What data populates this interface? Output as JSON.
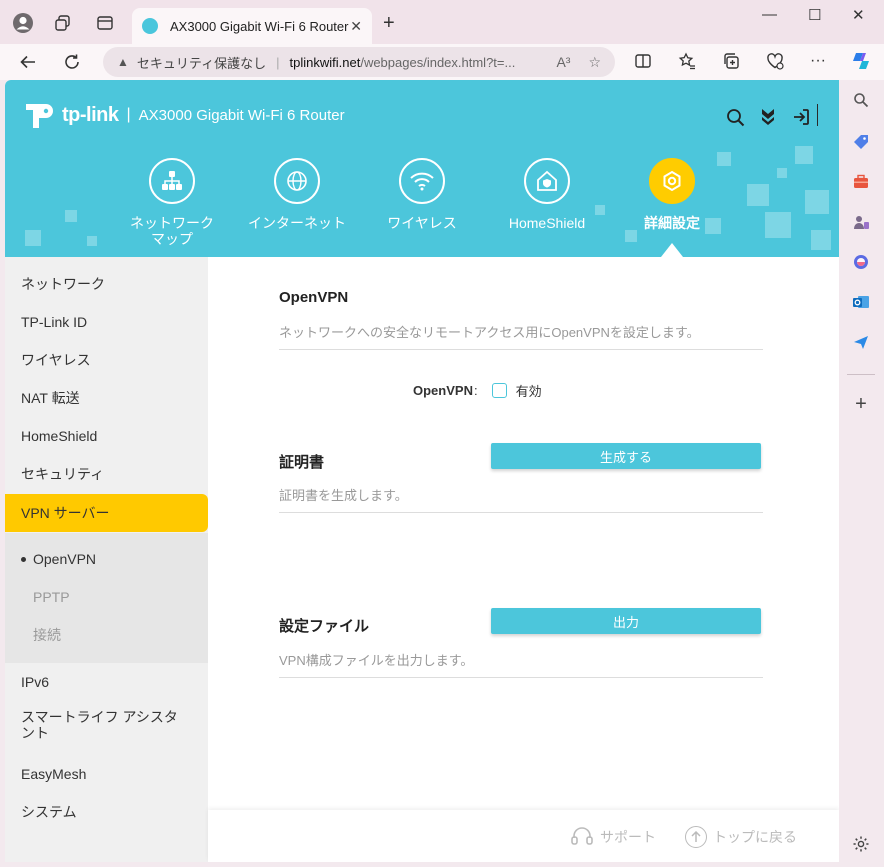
{
  "browser": {
    "tab_title": "AX3000 Gigabit Wi-Fi 6 Router",
    "tab_close": "✕",
    "new_tab": "+",
    "security_text": "セキュリティ保護なし",
    "url_host": "tplinkwifi.net",
    "url_path": "/webpages/index.html?t=...",
    "read_aloud": "A³",
    "fav_star": "☆",
    "menu_dots": "···",
    "win_min": "—",
    "win_max": "☐",
    "win_close": "✕"
  },
  "router": {
    "brand": "tp-link",
    "separator": "|",
    "model": "AX3000 Gigabit Wi-Fi 6 Router",
    "nav": [
      {
        "label": "ネットワーク\nマップ",
        "icon": "network-map-icon"
      },
      {
        "label": "インターネット",
        "icon": "globe-icon"
      },
      {
        "label": "ワイヤレス",
        "icon": "wifi-icon"
      },
      {
        "label": "HomeShield",
        "icon": "home-shield-icon"
      },
      {
        "label": "詳細設定",
        "icon": "gear-icon",
        "active": true
      }
    ],
    "sidebar": {
      "items": [
        {
          "label": "ネットワーク"
        },
        {
          "label": "TP-Link ID"
        },
        {
          "label": "ワイヤレス"
        },
        {
          "label": "NAT 転送"
        },
        {
          "label": "HomeShield"
        },
        {
          "label": "セキュリティ"
        },
        {
          "label": "VPN サーバー",
          "active": true
        },
        {
          "label": "IPv6"
        },
        {
          "label": "スマートライフ アシスタント"
        },
        {
          "label": "EasyMesh"
        },
        {
          "label": "システム"
        }
      ],
      "sub_items": [
        {
          "label": "OpenVPN",
          "current": true
        },
        {
          "label": "PPTP"
        },
        {
          "label": "接続"
        }
      ]
    },
    "main": {
      "openvpn": {
        "title": "OpenVPN",
        "desc": "ネットワークへの安全なリモートアクセス用にOpenVPNを設定します。",
        "field_label": "OpenVPN",
        "field_colon": ":",
        "checkbox_label": "有効",
        "checkbox_checked": false
      },
      "certificate": {
        "title": "証明書",
        "desc": "証明書を生成します。",
        "button": "生成する"
      },
      "config_file": {
        "title": "設定ファイル",
        "desc": "VPN構成ファイルを出力します。",
        "button": "出力"
      }
    },
    "footer": {
      "support": "サポート",
      "back_to_top": "トップに戻る"
    }
  },
  "colors": {
    "header": "#4cc6db",
    "active_yellow": "#ffc900",
    "button": "#4cc6db"
  }
}
